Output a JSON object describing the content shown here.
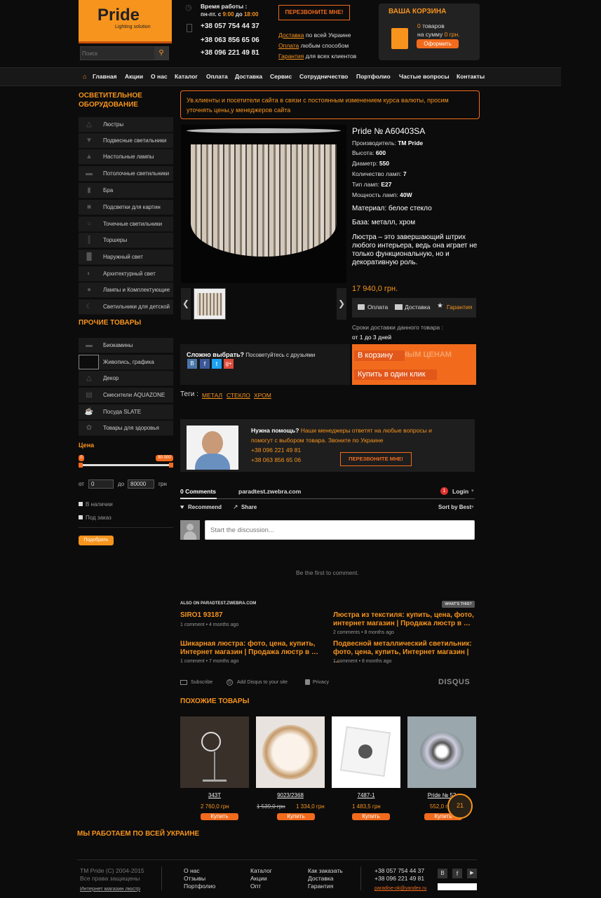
{
  "header": {
    "logo_main": "Pride",
    "logo_sub": "Lighting solution",
    "search_placeholder": "Поиск",
    "hours_label": "Время работы :",
    "hours_days": "пн-пт. с",
    "hours_from": "9:00",
    "hours_mid": "до",
    "hours_to": "18:00",
    "phones": [
      "+38 057 754 44 37",
      "+38 063 856 65 06",
      "+38 096 221 49 81"
    ],
    "callback": "ПЕРЕЗВОНИТЕ МНЕ!",
    "info": [
      {
        "link": "Доставка",
        "text": " по всей Украине"
      },
      {
        "link": "Оплата",
        "text": " любым способом"
      },
      {
        "link": "Гарантия",
        "text": " для всех клиентов"
      }
    ],
    "cart_title": "ВАША КОРЗИНА",
    "cart_count": "0",
    "cart_count_label": " товаров",
    "cart_sum_label": "на сумму ",
    "cart_sum": "0 грн.",
    "cart_checkout": "Оформить"
  },
  "nav": [
    "Главная",
    "Акции",
    "О нас",
    "Каталог",
    "Оплата",
    "Доставка",
    "Сервис",
    "Сотрудничество",
    "Портфолио",
    "Частые вопросы",
    "Контакты"
  ],
  "sidebar": {
    "lighting_title": "ОСВЕТИТЕЛЬНОЕ ОБОРУДОВАНИЕ",
    "lighting": [
      "Люстры",
      "Подвесные светильники",
      "Настольные лампы",
      "Потолочные светильники",
      "Бра",
      "Подсветки для картин",
      "Точечные светильники",
      "Торшеры",
      "Наружный свет",
      "Архитектурный свет",
      "Лампы и Комплектующие",
      "Светильники для детской"
    ],
    "other_title": "ПРОЧИЕ ТОВАРЫ",
    "other": [
      "Биокамины",
      "Живопись, графика",
      "Декор",
      "Смесители AQUAZONE",
      "Посуда SLATE",
      "Товары для здоровья"
    ],
    "price_title": "Цена",
    "price_min_badge": "0",
    "price_max_badge": "80 000",
    "from_label": "от",
    "to_label": "до",
    "from_value": "0",
    "to_value": "80000",
    "currency": "грн",
    "in_stock": "В наличии",
    "on_order": "Под заказ",
    "filter_btn": "Подобрать"
  },
  "notice": "Ув.клиенты и посетители сайта в связи с постоянным изменением курса валюты, просим уточнять цены,у менеджеров сайта",
  "product": {
    "title": "Pride № A60403SA",
    "specs": [
      {
        "label": "Производитель: ",
        "value": "TM Pride"
      },
      {
        "label": "Высота: ",
        "value": "600"
      },
      {
        "label": "Диаметр: ",
        "value": "550"
      },
      {
        "label": "Количество ламп: ",
        "value": "7"
      },
      {
        "label": "Тип ламп: ",
        "value": "E27"
      },
      {
        "label": "Мощность ламп: ",
        "value": "40W"
      }
    ],
    "material": "Материал: белое стекло",
    "base": "База: металл, хром",
    "description": "Люстра – это завершающий штрих любого интерьера, ведь она играет не только функциональную, но и декоративную роль.",
    "price": "17 940,0 грн.",
    "tabs": [
      "Оплата",
      "Доставка",
      "Гарантия"
    ],
    "delivery_label": "Сроки доставки данного товара :",
    "delivery_value": "от 1 до 3 дней",
    "promo_text": "ПО ВЫГОДНЫМ ЦЕНАМ",
    "add_to_cart": "В корзину",
    "buy_one_click": "Купить в один клик",
    "share_title": "Сложно выбрать?",
    "share_text": " Посоветуйтесь с друзьями",
    "tags_label": "Теги :",
    "tags": [
      "МЕТАЛ",
      "СТЕКЛО",
      "ХРОМ"
    ]
  },
  "help": {
    "title": "Нужна помощь?",
    "text": " Наши менеджеры ответят на любые вопросы и помогут с выбором товара. Звоните по Украине",
    "phones": [
      "+38 096 221 49 81",
      "+38 063 856 65 06"
    ],
    "callback": "ПЕРЕЗВОНИТЕ МНЕ!"
  },
  "disqus": {
    "comments": "0 Comments",
    "site": "paradtest.zwebra.com",
    "login": "Login",
    "badge": "1",
    "recommend": "Recommend",
    "share": "Share",
    "sort": "Sort by Best",
    "placeholder": "Start the discussion...",
    "empty": "Be the first to comment.",
    "also_on": "ALSO ON PARADTEST.ZWEBRA.COM",
    "whats_this": "WHAT'S THIS?",
    "items": [
      {
        "title": "SIRO1 93187",
        "meta": "1 comment • 4 months ago"
      },
      {
        "title": "Люстра из текстиля: купить, цена, фото, интернет магазин | Продажа люстр в …",
        "meta": "2 comments • 8 months ago"
      },
      {
        "title": "Шикарная люстра: фото, цена, купить, Интернет магазин | Продажа люстр в …",
        "meta": "1 comment • 7 months ago"
      },
      {
        "title": "Подвесной металлический светильник: фото, цена, купить, Интернет магазин | …",
        "meta": "1 comment • 8 months ago"
      }
    ],
    "subscribe": "Subscribe",
    "add_disqus": "Add Disqus to your site",
    "privacy": "Privacy",
    "brand": "DISQUS"
  },
  "similar": {
    "title": "ПОХОЖИЕ ТОВАРЫ",
    "items": [
      {
        "name": "343T",
        "price": "2 760,0 грн",
        "old": ""
      },
      {
        "name": "9023/2368",
        "price": "1 334,0 грн",
        "old": "1 539,0 грн"
      },
      {
        "name": "7487-1",
        "price": "1 483,5 грн",
        "old": ""
      },
      {
        "name": "Pride № 52",
        "price": "552,0 грн",
        "old": ""
      }
    ],
    "buy": "Купить",
    "counter": "21"
  },
  "ukraine": "МЫ РАБОТАЕМ ПО ВСЕЙ УКРАИНЕ",
  "footer": {
    "copyright": "TM Pride (C) 2004-2015",
    "rights": "Все права защищены",
    "shop_link": "Интернет магазин люстр",
    "col1": [
      "О нас",
      "Отзывы",
      "Портфолио"
    ],
    "col2": [
      "Каталог",
      "Акции",
      "Опт"
    ],
    "col3": [
      "Как заказать",
      "Доставка",
      "Гарантия"
    ],
    "phones": [
      "+38 057 754 44 37",
      "+38 096 221 49 81"
    ],
    "email": "paradise-ok@yandex.ru"
  },
  "colors": {
    "accent": "#f7941d",
    "button": "#f26b1d",
    "bg": "#0c0c0c"
  }
}
